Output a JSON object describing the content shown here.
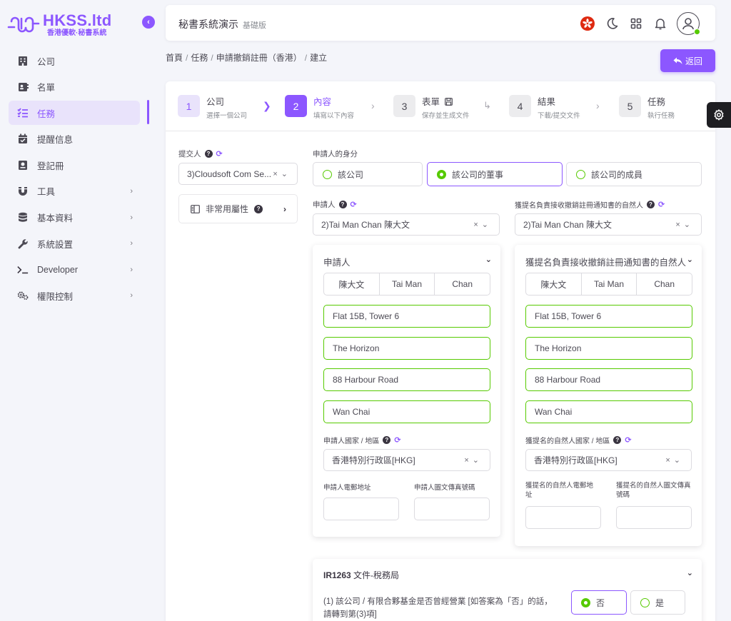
{
  "brand": {
    "name": "HKSS.ltd",
    "tagline": "香港優軟·秘書系統",
    "accent": "#8c57ff",
    "success": "#56ca00"
  },
  "sidebar": {
    "items": [
      {
        "label": "公司",
        "icon": "building-icon",
        "active": false,
        "expandable": false
      },
      {
        "label": "名單",
        "icon": "contact-card-icon",
        "active": false,
        "expandable": false
      },
      {
        "label": "任務",
        "icon": "checklist-icon",
        "active": true,
        "expandable": false
      },
      {
        "label": "提醒信息",
        "icon": "calendar-check-icon",
        "active": false,
        "expandable": false
      },
      {
        "label": "登記冊",
        "icon": "register-book-icon",
        "active": false,
        "expandable": false
      },
      {
        "label": "工具",
        "icon": "magnet-icon",
        "active": false,
        "expandable": true
      },
      {
        "label": "基本資料",
        "icon": "database-icon",
        "active": false,
        "expandable": true
      },
      {
        "label": "系統設置",
        "icon": "wrench-icon",
        "active": false,
        "expandable": true
      },
      {
        "label": "Developer",
        "icon": "terminal-icon",
        "active": false,
        "expandable": true
      },
      {
        "label": "權限控制",
        "icon": "cogs-icon",
        "active": false,
        "expandable": true
      }
    ]
  },
  "header": {
    "title": "秘書系統演示",
    "subtitle": "基礎版"
  },
  "breadcrumb": [
    "首頁",
    "任務",
    "申請撤銷註冊（香港）",
    "建立"
  ],
  "back_label": "返回",
  "stepper": [
    {
      "num": "1",
      "title": "公司",
      "sub": "選擇一個公司",
      "state": "done"
    },
    {
      "num": "2",
      "title": "內容",
      "sub": "填寫以下內容",
      "state": "active"
    },
    {
      "num": "3",
      "title": "表單",
      "sub": "保存並生成文件",
      "state": "inactive"
    },
    {
      "num": "4",
      "title": "結果",
      "sub": "下載/提交文件",
      "state": "inactive"
    },
    {
      "num": "5",
      "title": "任務",
      "sub": "執行任務",
      "state": "inactive"
    }
  ],
  "submitter": {
    "label": "提交人",
    "value": "3)Cloudsoft Com Se..."
  },
  "rare_attributes_label": "非常用屬性",
  "applicant_identity": {
    "label": "申請人的身分",
    "options": [
      "該公司",
      "該公司的董事",
      "該公司的成員"
    ],
    "selected_index": 1
  },
  "applicant": {
    "select_label": "申請人",
    "select_value": "2)Tai Man Chan 陳大文",
    "panel_title": "申請人",
    "name_parts": [
      "陳大文",
      "Tai Man",
      "Chan"
    ],
    "address": [
      "Flat 15B, Tower 6",
      "The Horizon",
      "88 Harbour Road",
      "Wan Chai"
    ],
    "country_label": "申請人國家 / 地區",
    "country_value": "香港特別行政區[HKG]",
    "email_label": "申請人電郵地址",
    "fax_label": "申請人圖文傳真號碼"
  },
  "nominee": {
    "select_label": "獲提名負責接收撤銷註冊通知書的自然人",
    "select_value": "2)Tai Man Chan 陳大文",
    "panel_title": "獲提名負責接收撤銷註冊通知書的自然人",
    "name_parts": [
      "陳大文",
      "Tai Man",
      "Chan"
    ],
    "address": [
      "Flat 15B, Tower 6",
      "The Horizon",
      "88 Harbour Road",
      "Wan Chai"
    ],
    "country_label": "獲提名的自然人國家 / 地區",
    "country_value": "香港特別行政區[HKG]",
    "email_label": "獲提名的自然人電郵地址",
    "fax_label": "獲提名的自然人圖文傳真號碼"
  },
  "ir1263": {
    "title_code": "IR1263",
    "title_text": "文件-稅務局",
    "question": "(1) 該公司 / 有限合夥基金是否曾經營業 [如答案為「否」的話，請轉到第(3)項]",
    "options": [
      "否",
      "是"
    ],
    "selected_index": 0
  }
}
